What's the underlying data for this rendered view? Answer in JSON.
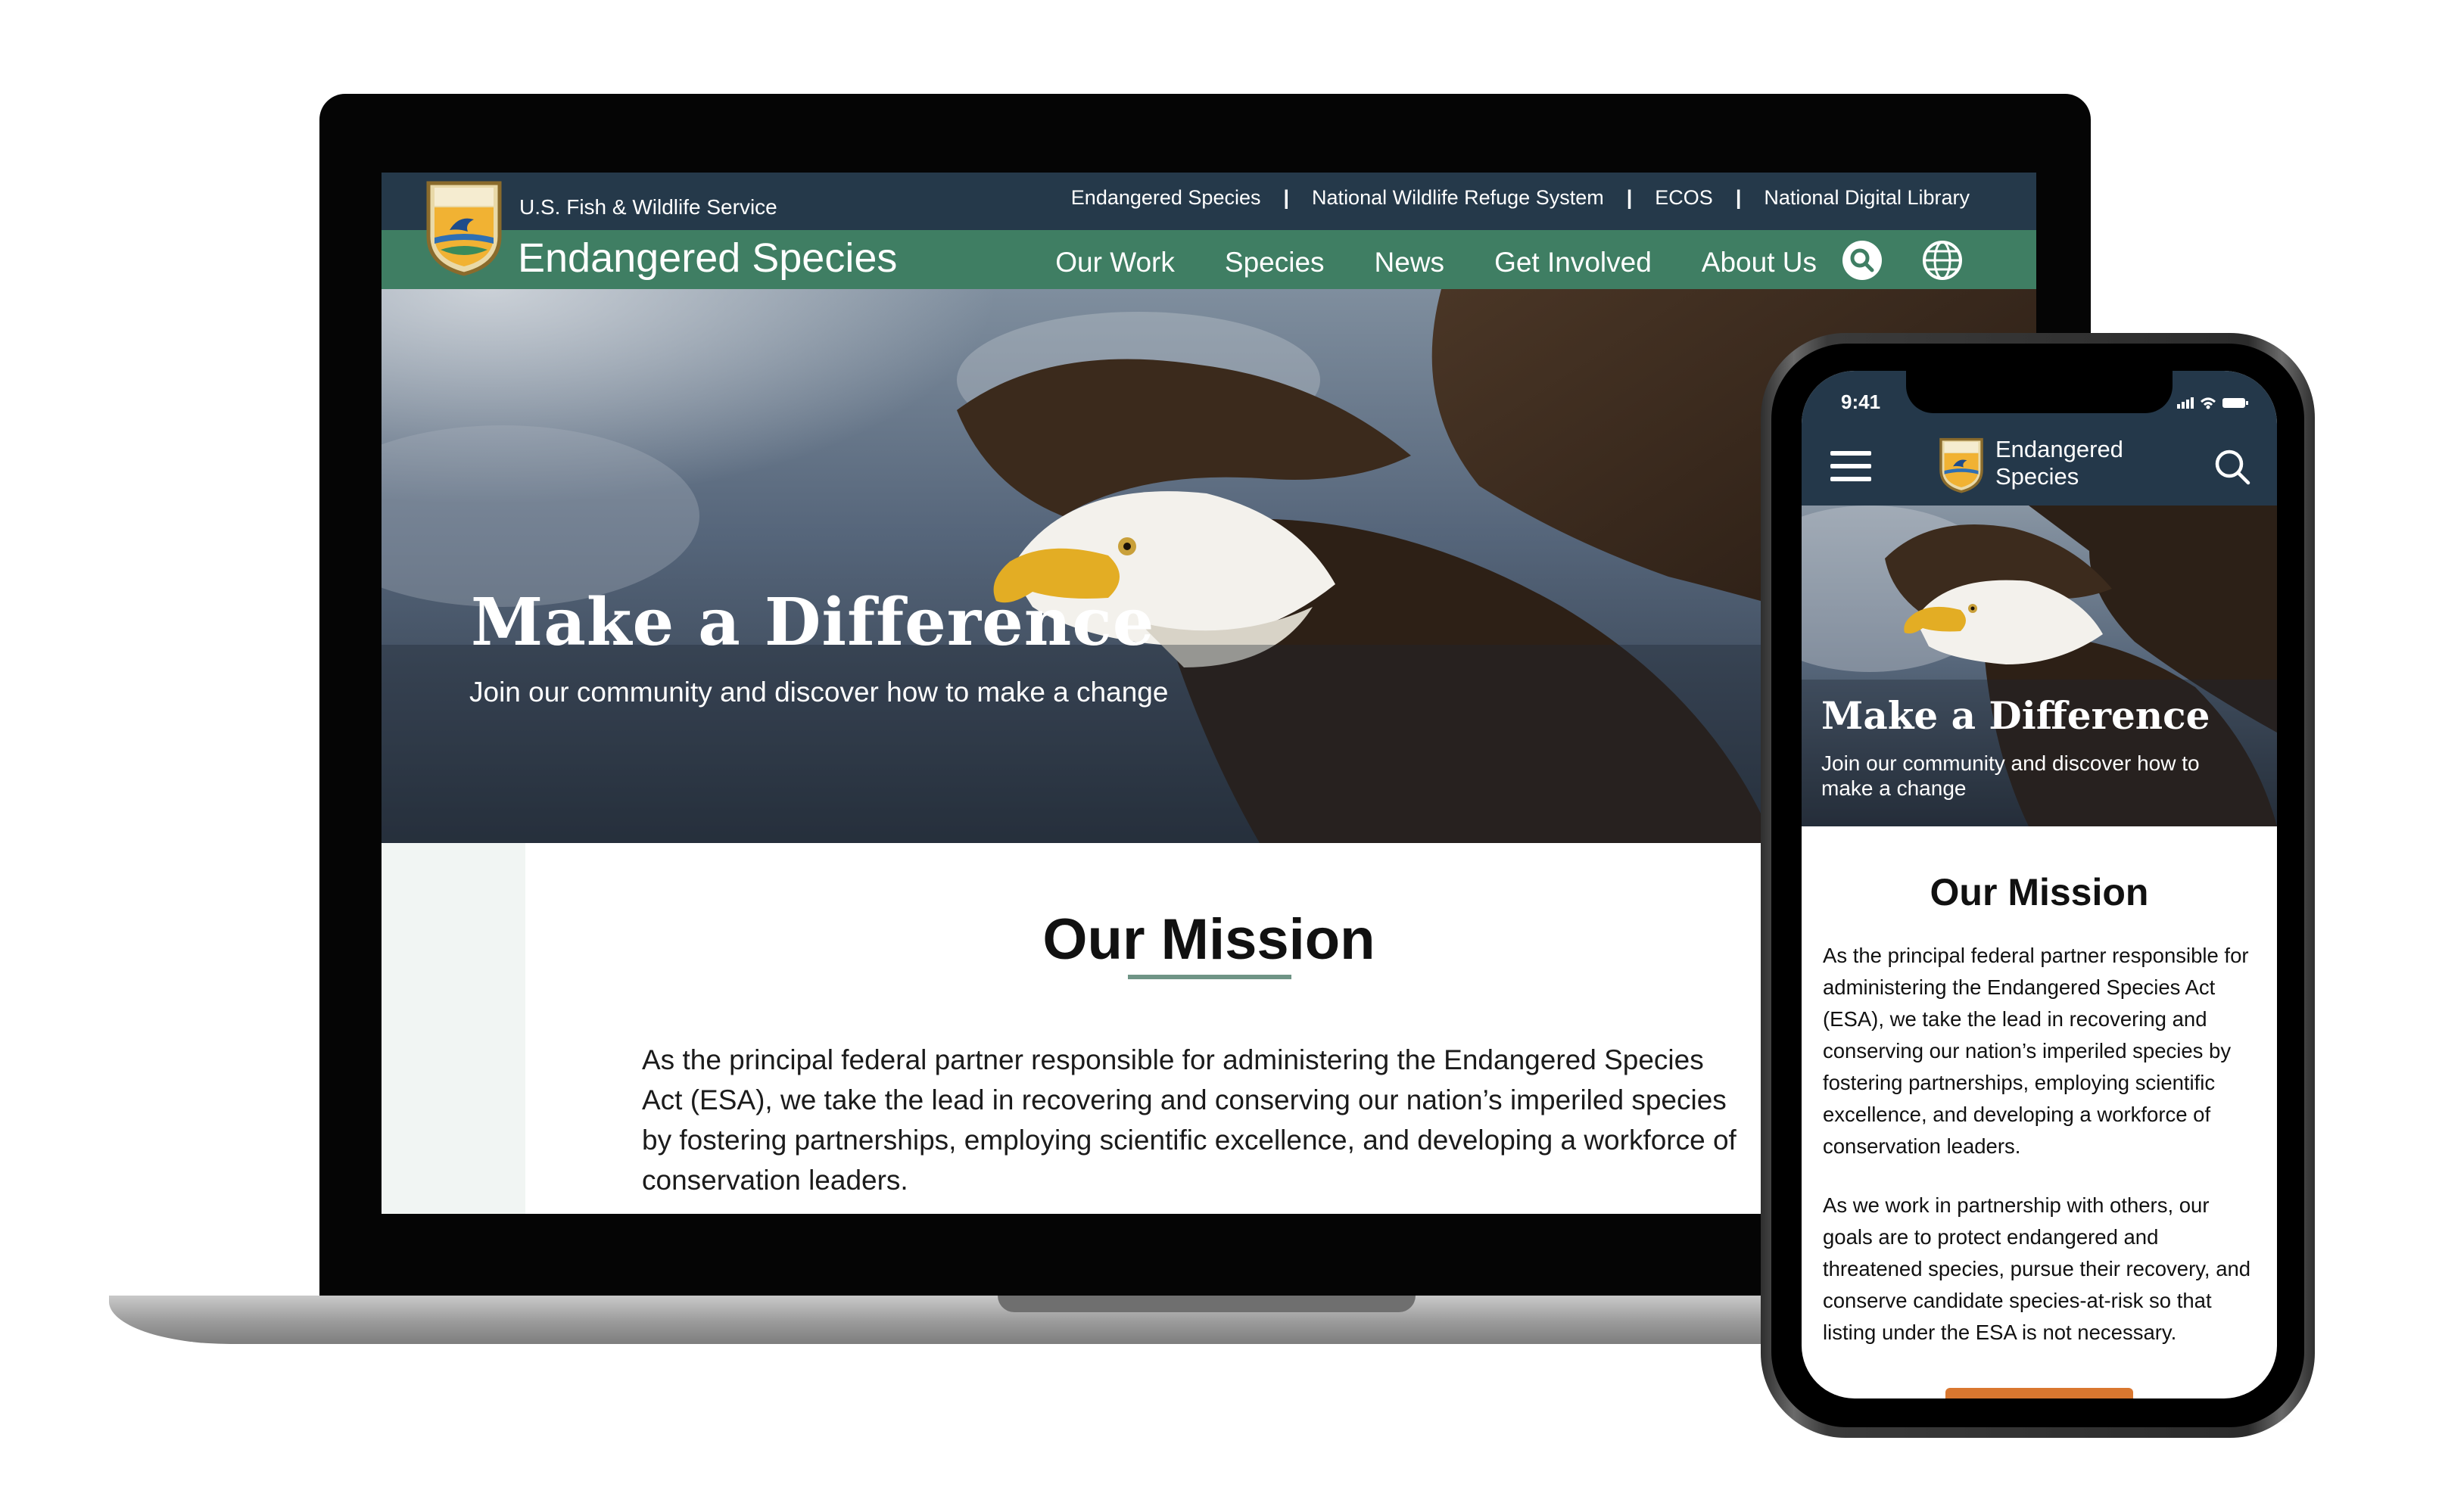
{
  "laptop": {
    "agency_name": "U.S. Fish & Wildlife Service",
    "top_links": [
      "Endangered Species",
      "National Wildlife Refuge System",
      "ECOS",
      "National Digital Library"
    ],
    "top_link_separator": "|",
    "site_title": "Endangered Species",
    "nav": [
      "Our Work",
      "Species",
      "News",
      "Get Involved",
      "About Us"
    ],
    "icons": {
      "search": "search-icon",
      "language": "globe-icon",
      "logo": "fws-logo"
    },
    "hero": {
      "title": "Make a Difference",
      "subtitle": "Join our community and discover how to make a change"
    },
    "mission": {
      "title": "Our Mission",
      "text": "As the principal federal partner responsible for administering the Endangered Species Act (ESA), we take the lead in recovering and conserving our nation’s imperiled species by fostering partnerships, employing scientific excellence, and developing a workforce of conservation leaders."
    }
  },
  "phone": {
    "status_time": "9:41",
    "site_title": "Endangered Species",
    "icons": {
      "menu": "hamburger-menu-icon",
      "search": "search-icon"
    },
    "hero": {
      "title": "Make a Difference",
      "subtitle": "Join our community and discover how to make a change"
    },
    "mission": {
      "title": "Our Mission",
      "paragraphs": [
        "As the principal federal partner responsible for administering the Endangered Species Act (ESA), we take the lead in recovering and conserving our nation’s imperiled species by fostering partnerships, employing scientific excellence, and developing a workforce of conservation leaders.",
        "As we work in partnership with others, our goals are to protect endangered and threatened species, pursue their recovery, and conserve candidate species-at-risk so that listing under the ESA is not necessary."
      ]
    }
  },
  "colors": {
    "navy": "#25394a",
    "green": "#3f7e63",
    "underline": "#6f9486",
    "accent_orange": "#d9772f"
  }
}
